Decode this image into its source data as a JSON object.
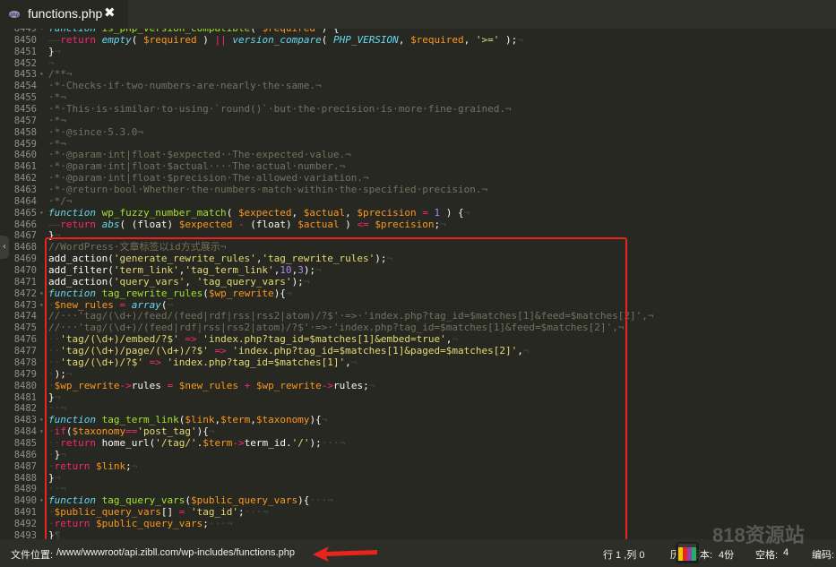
{
  "tab": {
    "title": "functions.php",
    "close": "✖"
  },
  "editor": {
    "lines": [
      {
        "n": "8449",
        "h": "<span class='k'>function</span> <span class='fn'>is_php_version_compatible</span>( <span class='v'>$required</span> ) {"
      },
      {
        "n": "8450",
        "h": "<span class='w'>——</span><span class='kw'>return</span> <span class='k'>empty</span>( <span class='v'>$required</span> ) <span class='kw'>||</span> <span class='k'>version_compare</span>( <span class='k'>PHP_VERSION</span>, <span class='v'>$required</span>, <span class='s'>'&gt;='</span> );<span class='w'>¬</span>"
      },
      {
        "n": "8451",
        "h": "}<span class='w'>¬</span>"
      },
      {
        "n": "8452",
        "h": "<span class='w'>¬</span>"
      },
      {
        "n": "8453",
        "h": "<span class='c'>/**¬</span>"
      },
      {
        "n": "8454",
        "h": "<span class='c'>·*·Checks·if·two·numbers·are·nearly·the·same.¬</span>"
      },
      {
        "n": "8455",
        "h": "<span class='c'>·*¬</span>"
      },
      {
        "n": "8456",
        "h": "<span class='c'>·*·This·is·similar·to·using·`round()`·but·the·precision·is·more·fine-grained.¬</span>"
      },
      {
        "n": "8457",
        "h": "<span class='c'>·*¬</span>"
      },
      {
        "n": "8458",
        "h": "<span class='c'>·*·@since·5.3.0¬</span>"
      },
      {
        "n": "8459",
        "h": "<span class='c'>·*¬</span>"
      },
      {
        "n": "8460",
        "h": "<span class='c'>·*·@param·int|float·$expected··The·expected·value.¬</span>"
      },
      {
        "n": "8461",
        "h": "<span class='c'>·*·@param·int|float·$actual····The·actual·number.¬</span>"
      },
      {
        "n": "8462",
        "h": "<span class='c'>·*·@param·int|float·$precision·The·allowed·variation.¬</span>"
      },
      {
        "n": "8463",
        "h": "<span class='c'>·*·@return·bool·Whether·the·numbers·match·within·the·specified·precision.¬</span>"
      },
      {
        "n": "8464",
        "h": "<span class='c'>·*/¬</span>"
      },
      {
        "n": "8465",
        "h": "<span class='k'>function</span> <span class='fn'>wp_fuzzy_number_match</span>( <span class='v'>$expected</span>, <span class='v'>$actual</span>, <span class='v'>$precision</span> <span class='kw'>=</span> <span class='n'>1</span> ) {<span class='w'>¬</span>"
      },
      {
        "n": "8466",
        "h": "<span class='w'>——</span><span class='kw'>return</span> <span class='k'>abs</span>( (float) <span class='v'>$expected</span> <span class='kw'>-</span> (float) <span class='v'>$actual</span> ) <span class='kw'>&lt;=</span> <span class='v'>$precision</span>;<span class='w'>¬</span>"
      },
      {
        "n": "8467",
        "h": "}<span class='w'>¬</span>"
      },
      {
        "n": "8468",
        "h": "<span class='c'>//WordPress·文章标签以id方式展示¬</span>"
      },
      {
        "n": "8469",
        "h": "add_action(<span class='s'>'generate_rewrite_rules'</span>,<span class='s'>'tag_rewrite_rules'</span>);<span class='w'>¬</span>"
      },
      {
        "n": "8470",
        "h": "add_filter(<span class='s'>'term_link'</span>,<span class='s'>'tag_term_link'</span>,<span class='n'>10</span>,<span class='n'>3</span>);<span class='w'>¬</span>"
      },
      {
        "n": "8471",
        "h": "add_action(<span class='s'>'query_vars'</span>, <span class='s'>'tag_query_vars'</span>);<span class='w'>¬</span>"
      },
      {
        "n": "8472",
        "h": "<span class='k'>function</span> <span class='fn'>tag_rewrite_rules</span>(<span class='v'>$wp_rewrite</span>){<span class='w'>¬</span>"
      },
      {
        "n": "8473",
        "h": "<span class='w'>·</span><span class='v'>$new_rules</span> <span class='kw'>=</span> <span class='k'>array</span>(<span class='w'>¬</span>"
      },
      {
        "n": "8474",
        "h": "<span class='c'>//···'tag/(\\d+)/feed/(feed|rdf|rss|rss2|atom)/?$'·=&gt;·'index.php?tag_id=$matches[1]&amp;feed=$matches[2]',¬</span>"
      },
      {
        "n": "8475",
        "h": "<span class='c'>//···'tag/(\\d+)/(feed|rdf|rss|rss2|atom)/?$'·=&gt;·'index.php?tag_id=$matches[1]&amp;feed=$matches[2]',¬</span>"
      },
      {
        "n": "8476",
        "h": "<span class='w'>··</span><span class='s'>'tag/(\\d+)/embed/?$'</span> <span class='kw'>=&gt;</span> <span class='s'>'index.php?tag_id=$matches[1]&amp;embed=true'</span>,<span class='w'>¬</span>"
      },
      {
        "n": "8477",
        "h": "<span class='w'>··</span><span class='s'>'tag/(\\d+)/page/(\\d+)/?$'</span> <span class='kw'>=&gt;</span> <span class='s'>'index.php?tag_id=$matches[1]&amp;paged=$matches[2]'</span>,<span class='w'>¬</span>"
      },
      {
        "n": "8478",
        "h": "<span class='w'>··</span><span class='s'>'tag/(\\d+)/?$'</span> <span class='kw'>=&gt;</span> <span class='s'>'index.php?tag_id=$matches[1]'</span>,<span class='w'>¬</span>"
      },
      {
        "n": "8479",
        "h": "<span class='w'>·</span>);<span class='w'>¬</span>"
      },
      {
        "n": "8480",
        "h": "<span class='w'>·</span><span class='v'>$wp_rewrite</span><span class='kw'>-&gt;</span>rules <span class='kw'>=</span> <span class='v'>$new_rules</span> <span class='kw'>+</span> <span class='v'>$wp_rewrite</span><span class='kw'>-&gt;</span>rules;<span class='w'>¬</span>"
      },
      {
        "n": "8481",
        "h": "}<span class='w'>¬</span>"
      },
      {
        "n": "8482",
        "h": "<span class='w'>··¬</span>"
      },
      {
        "n": "8483",
        "h": "<span class='k'>function</span> <span class='fn'>tag_term_link</span>(<span class='v'>$link</span>,<span class='v'>$term</span>,<span class='v'>$taxonomy</span>){<span class='w'>¬</span>"
      },
      {
        "n": "8484",
        "h": "<span class='w'>·</span><span class='kw'>if</span>(<span class='v'>$taxonomy</span><span class='kw'>==</span><span class='s'>'post_tag'</span>){<span class='w'>¬</span>"
      },
      {
        "n": "8485",
        "h": "<span class='w'>··</span><span class='kw'>return</span> home_url(<span class='s'>'/tag/'</span>.<span class='v'>$term</span><span class='kw'>-&gt;</span>term_id.<span class='s'>'/'</span>);<span class='w'>···¬</span>"
      },
      {
        "n": "8486",
        "h": "<span class='w'>·</span>}<span class='w'>¬</span>"
      },
      {
        "n": "8487",
        "h": "<span class='w'>·</span><span class='kw'>return</span> <span class='v'>$link</span>;<span class='w'>¬</span>"
      },
      {
        "n": "8488",
        "h": "}<span class='w'>¬</span>"
      },
      {
        "n": "8489",
        "h": "<span class='w'>··¬</span>"
      },
      {
        "n": "8490",
        "h": "<span class='k'>function</span> <span class='fn'>tag_query_vars</span>(<span class='v'>$public_query_vars</span>){<span class='w'>···¬</span>"
      },
      {
        "n": "8491",
        "h": "<span class='w'>·</span><span class='v'>$public_query_vars</span>[] <span class='kw'>=</span> <span class='s'>'tag_id'</span>;<span class='w'>···¬</span>"
      },
      {
        "n": "8492",
        "h": "<span class='w'>·</span><span class='kw'>return</span> <span class='v'>$public_query_vars</span>;<span class='w'>···¬</span>"
      },
      {
        "n": "8493",
        "h": "}<span class='w'>¶</span>"
      }
    ]
  },
  "status": {
    "file_label": "文件位置:",
    "file_path": "/www/wwwroot/api.zibll.com/wp-includes/functions.php",
    "position": "行 1 ,列 0",
    "history": "历史版本:",
    "history_count": "4份",
    "spaces_label": "空格:",
    "spaces_value": "4",
    "encoding_label": "编码:"
  },
  "watermark": "818资源站",
  "colors": {
    "background": "#272822",
    "highlight_border": "#e8251c",
    "arrow": "#e8251c"
  }
}
